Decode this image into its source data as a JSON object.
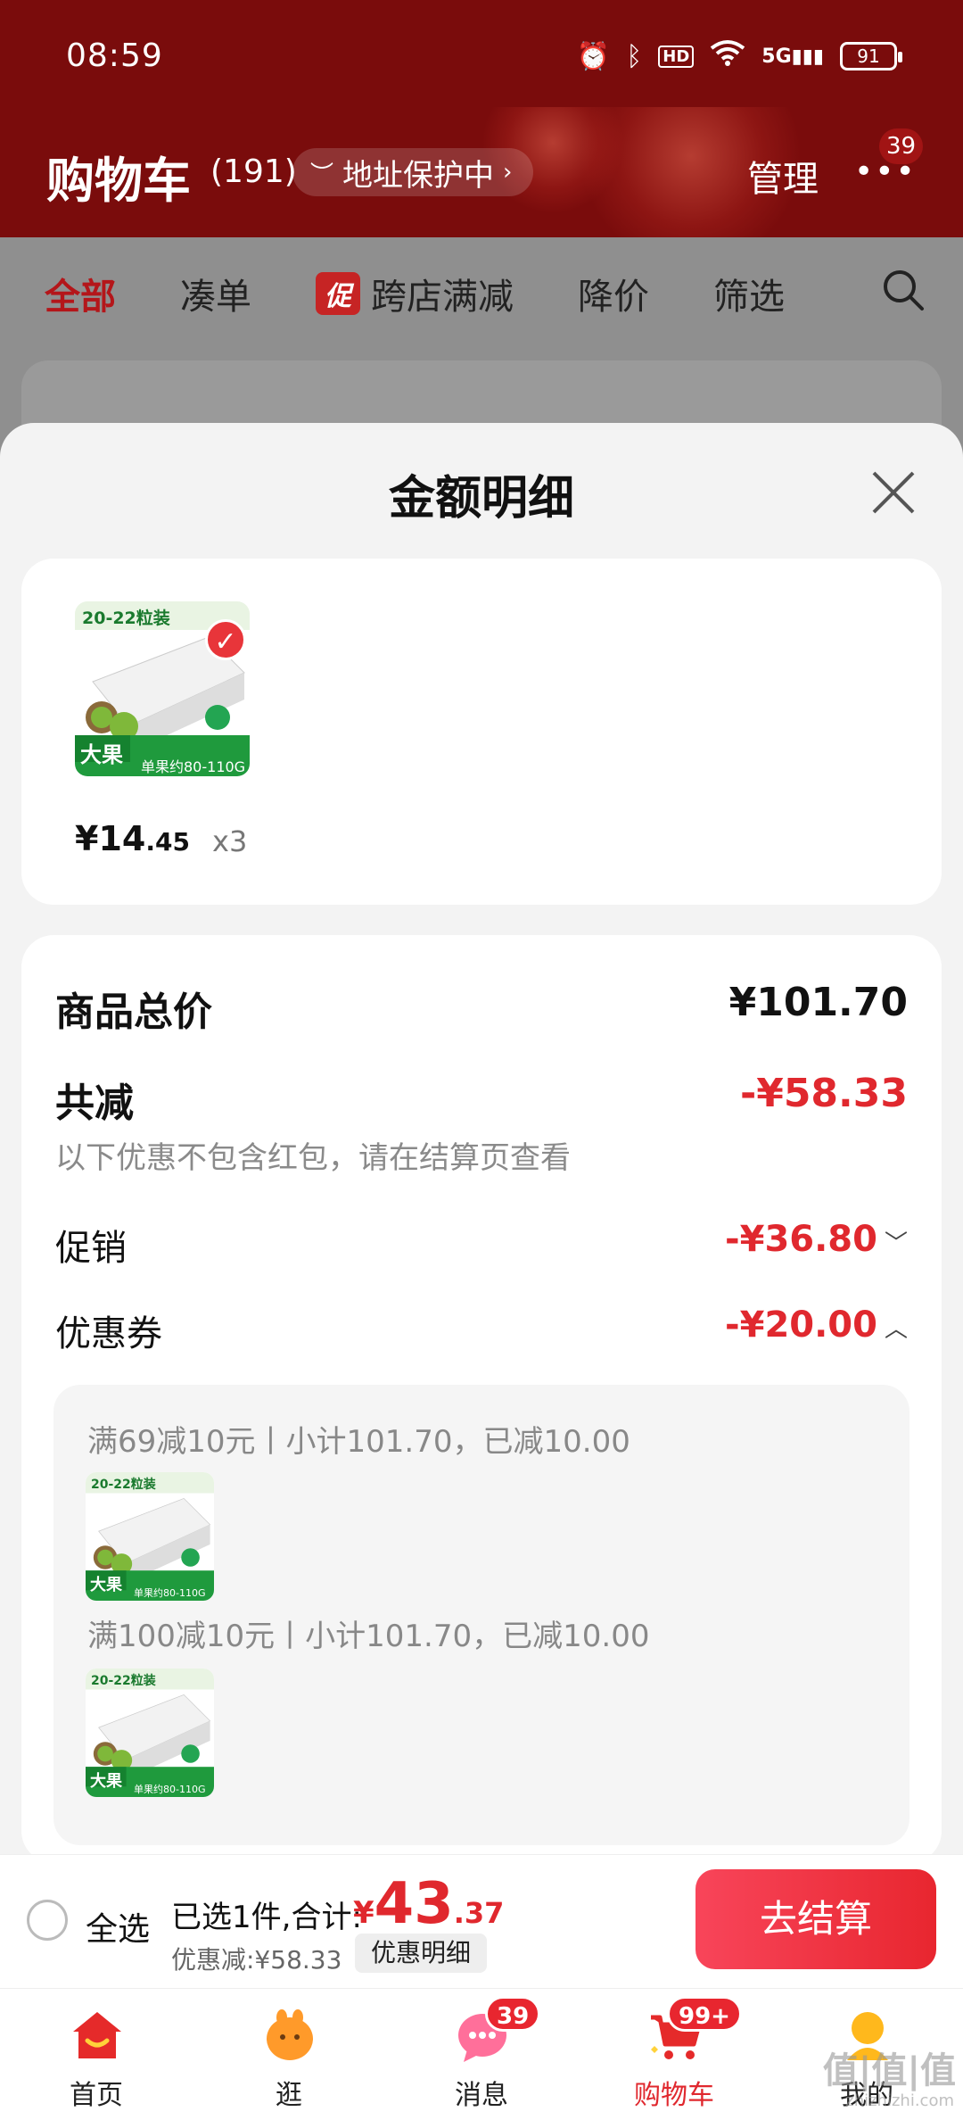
{
  "status_bar": {
    "time": "08:59",
    "battery": "91",
    "network": "5G"
  },
  "header": {
    "title": "购物车",
    "count": "(191)",
    "address_protect": "地址保护中",
    "manage": "管理",
    "more_badge": "39"
  },
  "filters": {
    "items": [
      "全部",
      "凑单",
      "跨店满减",
      "降价",
      "筛选"
    ],
    "promo_tag": "促"
  },
  "sheet": {
    "title": "金额明细",
    "product": {
      "thumb_top_text": "20-22粒装",
      "thumb_badge_text": "大果",
      "thumb_weight_text": "单果约80-110G",
      "price_int": "¥14",
      "price_dec": ".45",
      "quantity": "x3"
    },
    "total_label": "商品总价",
    "total_value": "¥101.70",
    "reduce_label": "共减",
    "reduce_value": "-¥58.33",
    "reduce_hint": "以下优惠不包含红包，请在结算页查看",
    "promo_label": "促销",
    "promo_value": "-¥36.80",
    "coupon_label": "优惠券",
    "coupon_value": "-¥20.00",
    "coupon_lines": [
      "满69减10元丨小计101.70，已减10.00",
      "满100减10元丨小计101.70，已减10.00"
    ]
  },
  "bottom_bar": {
    "select_all": "全选",
    "selected_info": "已选1件,合计:",
    "total_yen": "¥",
    "total_int": "43",
    "total_dec": ".37",
    "discount": "优惠减:¥58.33",
    "detail_button": "优惠明细",
    "checkout": "去结算"
  },
  "tabbar": {
    "tabs": [
      {
        "label": "首页"
      },
      {
        "label": "逛"
      },
      {
        "label": "消息",
        "badge": "39"
      },
      {
        "label": "购物车",
        "badge": "99+"
      },
      {
        "label": "我的"
      }
    ]
  },
  "watermark": {
    "main": "值|值|值",
    "sub": "zhizhizhi.com"
  },
  "colors": {
    "header_bg": "#7a0c0c",
    "accent_red": "#e0282e",
    "checkout_gradient_start": "#f8455a"
  }
}
